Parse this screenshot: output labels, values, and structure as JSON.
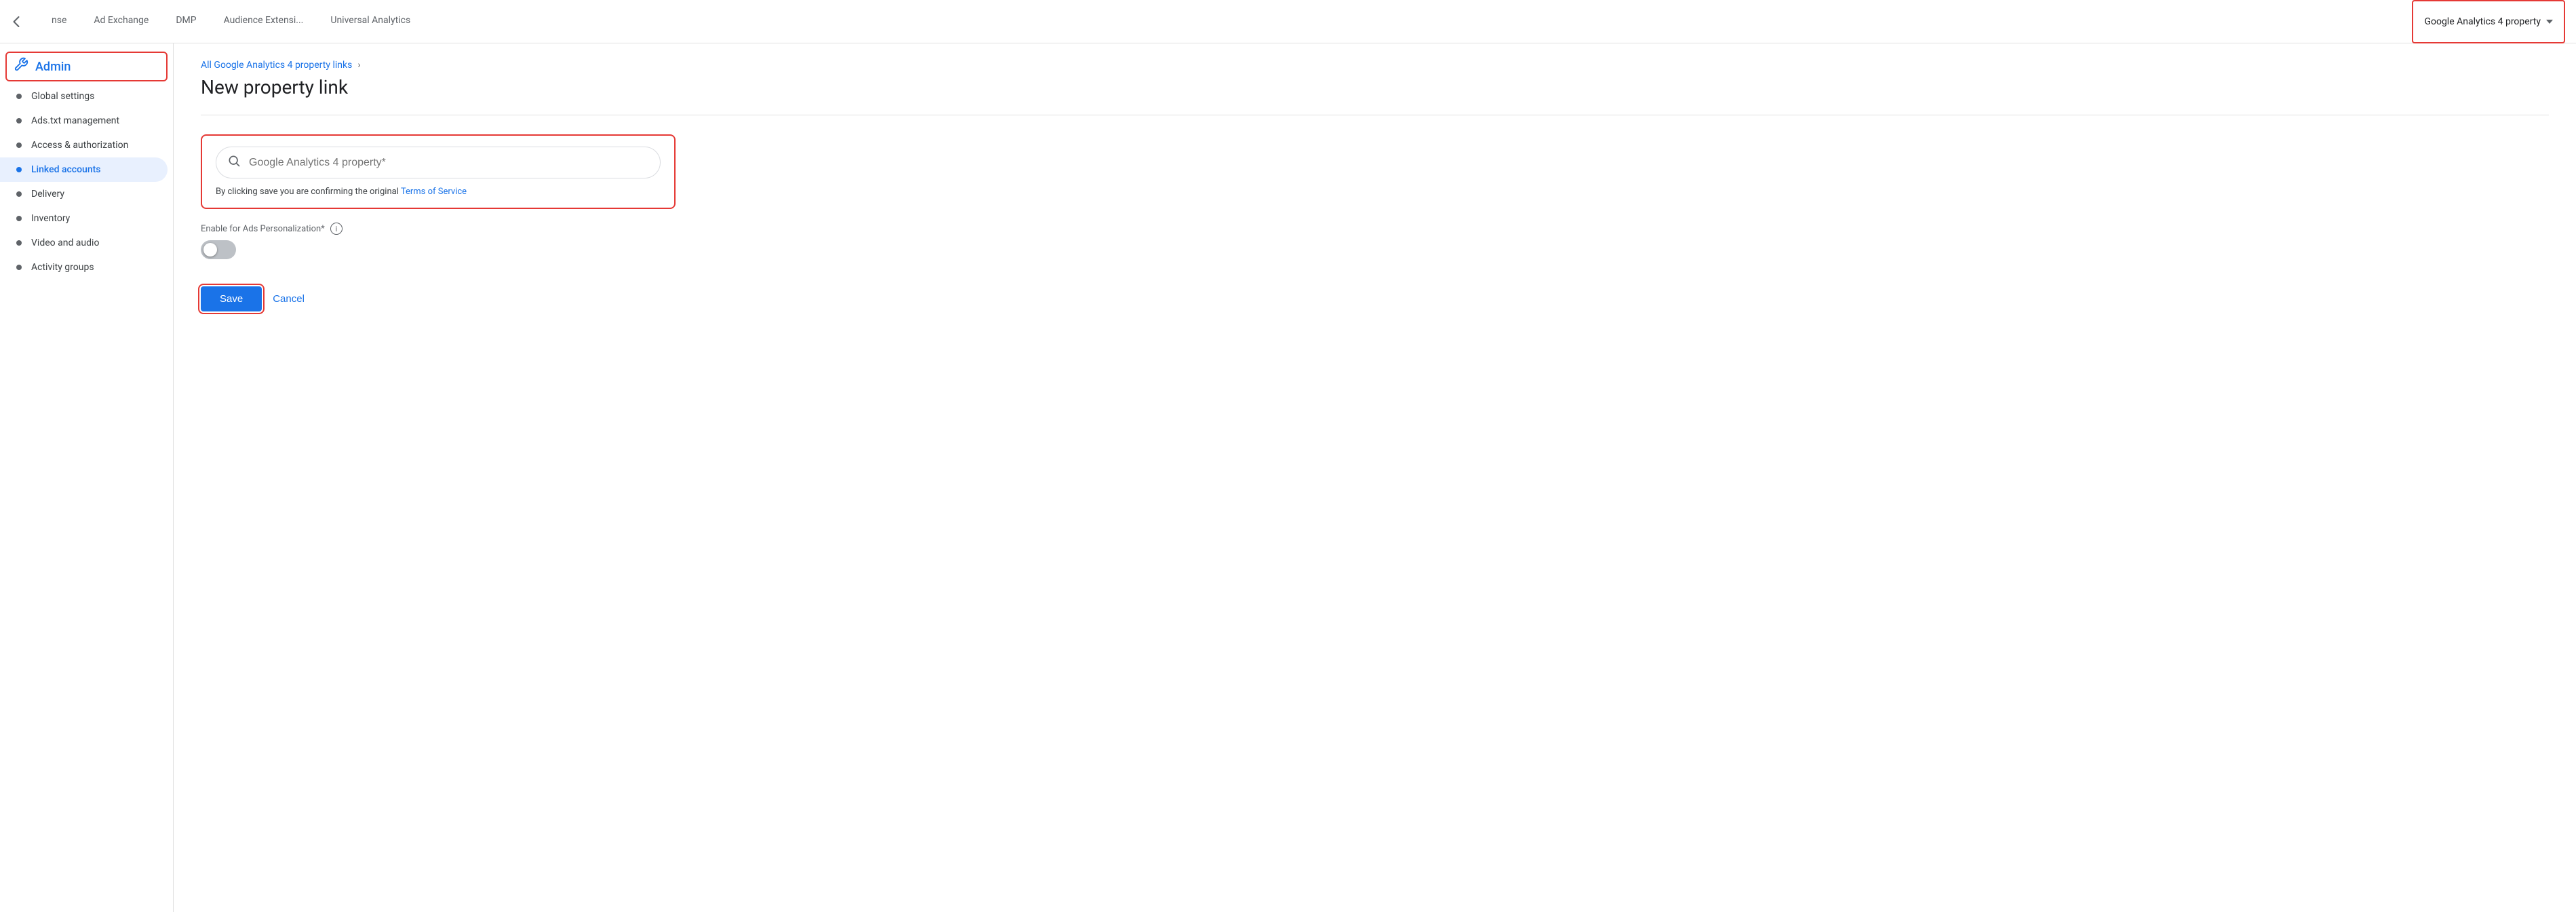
{
  "topNav": {
    "backButton": "‹",
    "tabs": [
      {
        "label": "nse",
        "active": false
      },
      {
        "label": "Ad Exchange",
        "active": false
      },
      {
        "label": "DMP",
        "active": false
      },
      {
        "label": "Audience Extensi...",
        "active": false
      },
      {
        "label": "Universal Analytics",
        "active": false
      }
    ],
    "dropdown": {
      "label": "Google Analytics 4 property",
      "active": true
    }
  },
  "sidebar": {
    "header": {
      "icon": "🔧",
      "label": "Admin"
    },
    "items": [
      {
        "label": "Global settings",
        "active": false
      },
      {
        "label": "Ads.txt management",
        "active": false
      },
      {
        "label": "Access & authorization",
        "active": false
      },
      {
        "label": "Linked accounts",
        "active": true
      },
      {
        "label": "Delivery",
        "active": false
      },
      {
        "label": "Inventory",
        "active": false
      },
      {
        "label": "Video and audio",
        "active": false
      },
      {
        "label": "Activity groups",
        "active": false
      }
    ]
  },
  "breadcrumb": {
    "linkText": "All Google Analytics 4 property links",
    "chevron": "›"
  },
  "pageTitle": "New property link",
  "searchBox": {
    "placeholder": "Google Analytics 4 property*",
    "searchIconLabel": "search"
  },
  "tosText": {
    "prefix": "By clicking save you are confirming the original ",
    "linkText": "Terms of Service"
  },
  "toggleSection": {
    "label": "Enable for Ads Personalization*",
    "infoIcon": "i"
  },
  "buttons": {
    "save": "Save",
    "cancel": "Cancel"
  }
}
